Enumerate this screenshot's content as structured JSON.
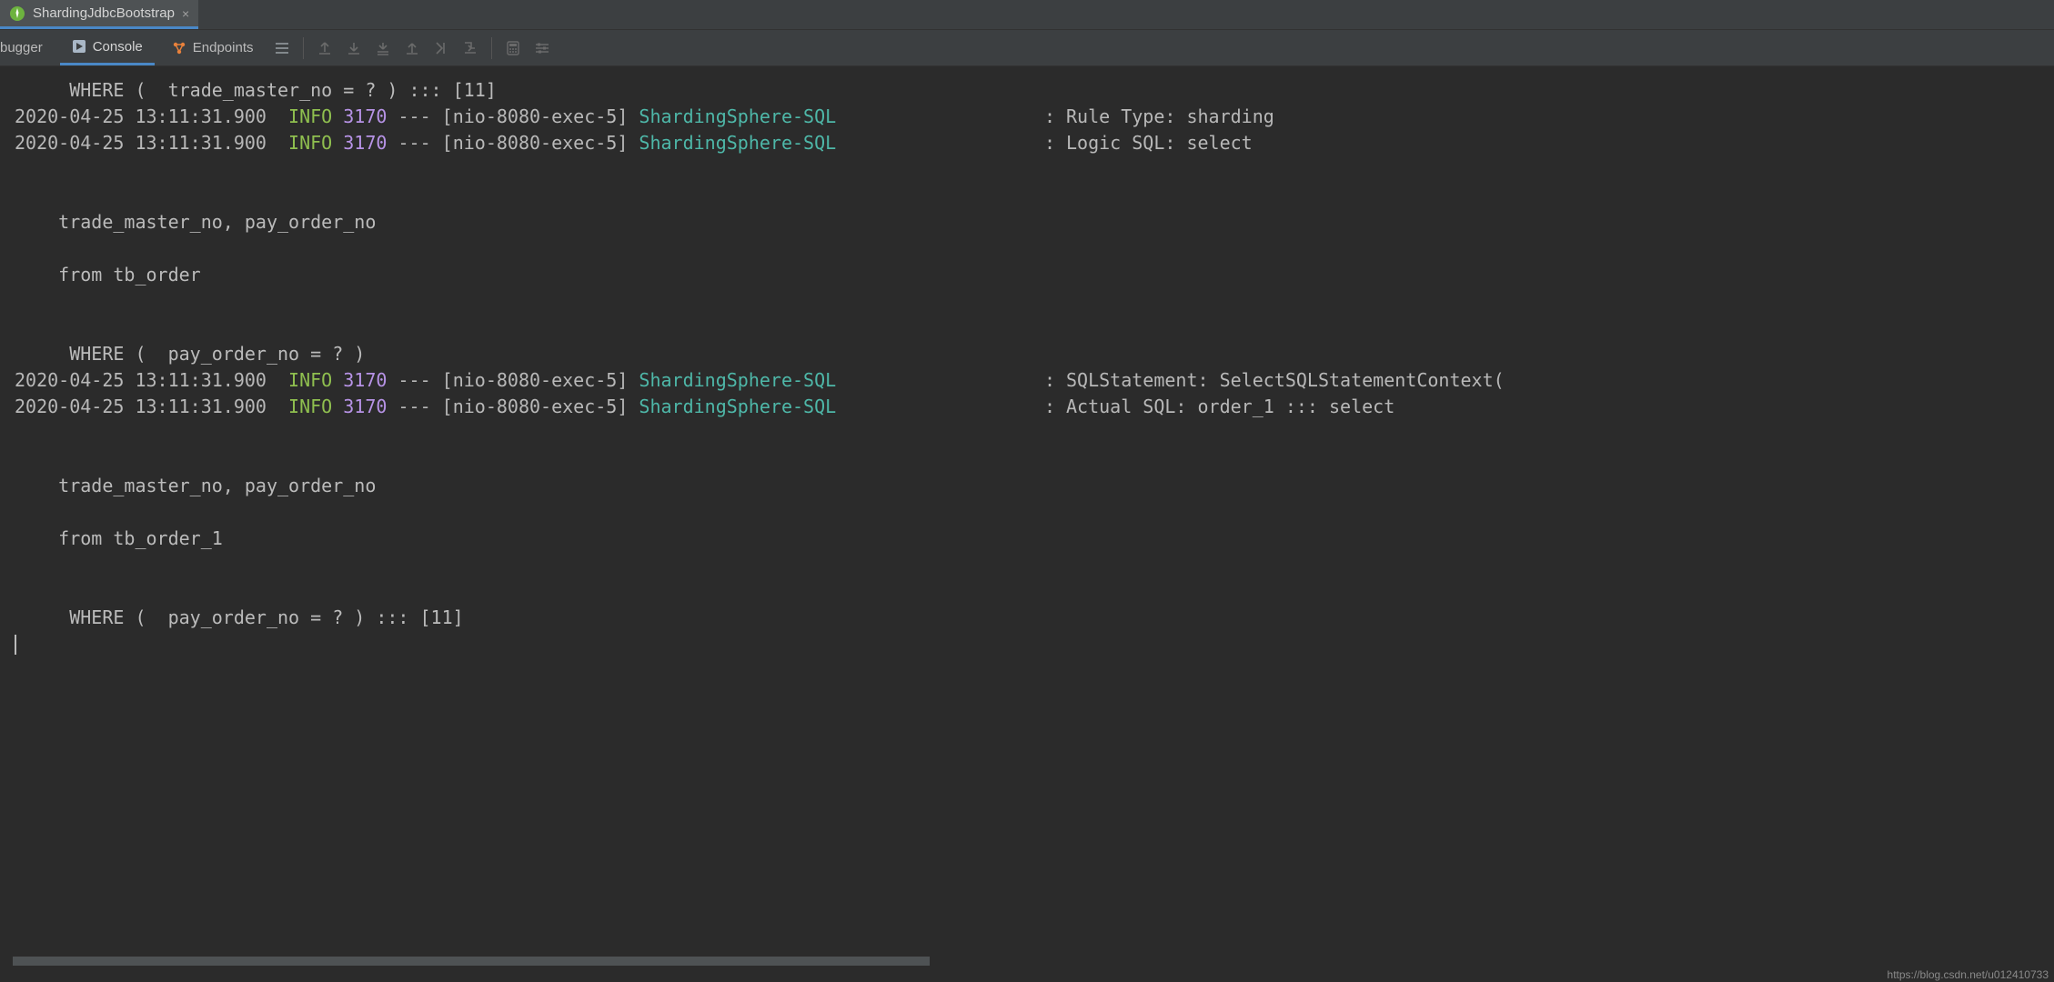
{
  "editor_tab": {
    "title": "ShardingJdbcBootstrap"
  },
  "tool_tabs": {
    "debugger": "bugger",
    "console": "Console",
    "endpoints": "Endpoints",
    "active": "console"
  },
  "console": {
    "lines": [
      {
        "type": "plain",
        "text": "     WHERE (  trade_master_no = ? ) ::: [11]"
      },
      {
        "type": "log",
        "ts": "2020-04-25 13:11:31.900",
        "level": "INFO",
        "pid": "3170",
        "sep": "---",
        "thread": "[nio-8080-exec-5]",
        "logger": "ShardingSphere-SQL",
        "pad": "                   ",
        "msg": ": Rule Type: sharding"
      },
      {
        "type": "log",
        "ts": "2020-04-25 13:11:31.900",
        "level": "INFO",
        "pid": "3170",
        "sep": "---",
        "thread": "[nio-8080-exec-5]",
        "logger": "ShardingSphere-SQL",
        "pad": "                   ",
        "msg": ": Logic SQL: select"
      },
      {
        "type": "plain",
        "text": "     "
      },
      {
        "type": "plain",
        "text": " "
      },
      {
        "type": "plain",
        "text": "    trade_master_no, pay_order_no"
      },
      {
        "type": "plain",
        "text": "     "
      },
      {
        "type": "plain",
        "text": "    from tb_order"
      },
      {
        "type": "plain",
        "text": "    "
      },
      {
        "type": "plain",
        "text": "     "
      },
      {
        "type": "plain",
        "text": "     WHERE (  pay_order_no = ? )"
      },
      {
        "type": "log",
        "ts": "2020-04-25 13:11:31.900",
        "level": "INFO",
        "pid": "3170",
        "sep": "---",
        "thread": "[nio-8080-exec-5]",
        "logger": "ShardingSphere-SQL",
        "pad": "                   ",
        "msg": ": SQLStatement: SelectSQLStatementContext("
      },
      {
        "type": "log",
        "ts": "2020-04-25 13:11:31.900",
        "level": "INFO",
        "pid": "3170",
        "sep": "---",
        "thread": "[nio-8080-exec-5]",
        "logger": "ShardingSphere-SQL",
        "pad": "                   ",
        "msg": ": Actual SQL: order_1 ::: select"
      },
      {
        "type": "plain",
        "text": "     "
      },
      {
        "type": "plain",
        "text": " "
      },
      {
        "type": "plain",
        "text": "    trade_master_no, pay_order_no"
      },
      {
        "type": "plain",
        "text": "     "
      },
      {
        "type": "plain",
        "text": "    from tb_order_1"
      },
      {
        "type": "plain",
        "text": "    "
      },
      {
        "type": "plain",
        "text": "     "
      },
      {
        "type": "plain",
        "text": "     WHERE (  pay_order_no = ? ) ::: [11]"
      }
    ]
  },
  "status_bar": {
    "right_text": "https://blog.csdn.net/u012410733"
  }
}
